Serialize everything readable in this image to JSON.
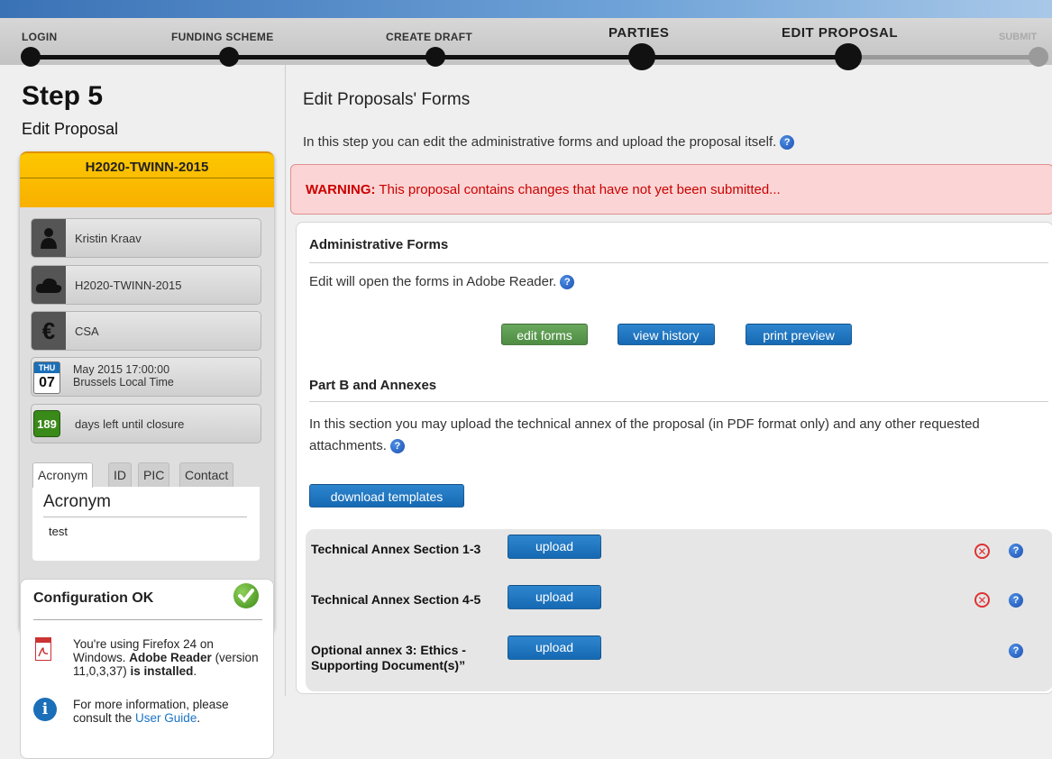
{
  "steps": {
    "login": "LOGIN",
    "funding": "FUNDING SCHEME",
    "draft": "CREATE DRAFT",
    "parties": "PARTIES",
    "edit": "EDIT PROPOSAL",
    "submit": "SUBMIT"
  },
  "sidebar": {
    "step_title": "Step 5",
    "step_subtitle": "Edit Proposal",
    "call_id": "H2020-TWINN-2015",
    "user": "Kristin Kraav",
    "call": "H2020-TWINN-2015",
    "type": "CSA",
    "deadline_month": "THU",
    "deadline_day": "07",
    "deadline_line1": "May 2015  17:00:00",
    "deadline_line2": "Brussels Local Time",
    "days_left": "189",
    "days_left_text": "days left until closure",
    "tabs": [
      "Acronym",
      "ID",
      "PIC",
      "Contact"
    ],
    "tab_heading": "Acronym",
    "tab_value": "test"
  },
  "config": {
    "title": "Configuration OK",
    "line_a": "You're using Firefox 24 on Windows. ",
    "line_b": "Adobe Reader",
    "line_c": " (version 11,0,3,37) ",
    "line_d": "is installed",
    "line_e": ".",
    "info_a": "For more information, please consult the ",
    "info_link": "User Guide",
    "info_b": "."
  },
  "main": {
    "title": "Edit Proposals' Forms",
    "intro": "In this step you can edit the administrative forms and upload the proposal itself.",
    "warning_label": "WARNING:",
    "warning_text": " This proposal contains changes that have not yet been submitted...",
    "admin_title": "Administrative Forms",
    "admin_text": "Edit will open the forms in Adobe Reader.",
    "btn_edit": "edit forms",
    "btn_history": "view history",
    "btn_print": "print preview",
    "partb_title": "Part B and Annexes",
    "partb_text": "In this section you may upload the technical annex of the proposal (in PDF format only) and any other requested attachments.",
    "btn_templates": "download templates",
    "uploads": [
      {
        "label": "Technical Annex Section 1-3",
        "button": "upload"
      },
      {
        "label": "Technical Annex Section 4-5",
        "button": "upload"
      },
      {
        "label": "Optional annex 3: Ethics - Supporting Document(s)”",
        "button": "upload"
      }
    ]
  },
  "colors": {
    "accent_blue": "#1669b3",
    "green": "#4f8c43",
    "warning_red": "#cc0000",
    "call_orange": "#fdc700"
  }
}
